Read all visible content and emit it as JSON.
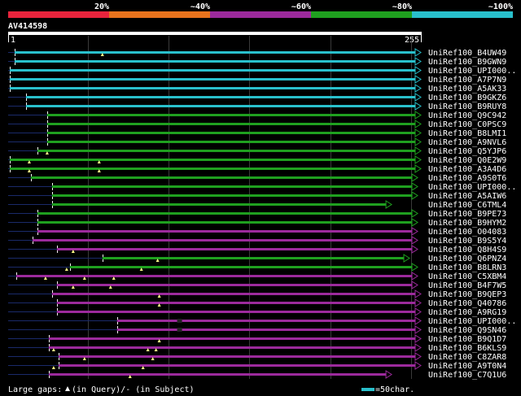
{
  "legend": {
    "segments": [
      {
        "label": "20%",
        "color": "#e8243c"
      },
      {
        "label": "~40%",
        "color": "#e8731d"
      },
      {
        "label": "~60%",
        "color": "#9c2a9c"
      },
      {
        "label": "~80%",
        "color": "#1fa01f"
      },
      {
        "label": "~100%",
        "color": "#29c0cc"
      }
    ]
  },
  "query": {
    "name": "AV414598",
    "start": "1",
    "end": "255",
    "length": 255
  },
  "colors": {
    "cyan": "#29c0cc",
    "green": "#1fa01f",
    "purple": "#9c2a9c",
    "gap": "#1a2a6a"
  },
  "hits": [
    {
      "name": "UniRef100_B4UW49",
      "color": "cyan",
      "start": 5,
      "end": 255,
      "gaps": [],
      "marks": [
        59
      ]
    },
    {
      "name": "UniRef100_B9GWN9",
      "color": "cyan",
      "start": 5,
      "end": 255,
      "gaps": [],
      "marks": []
    },
    {
      "name": "UniRef100_UPI000..",
      "color": "cyan",
      "start": 2,
      "end": 255,
      "gaps": [],
      "marks": []
    },
    {
      "name": "UniRef100_A7P7N9",
      "color": "cyan",
      "start": 2,
      "end": 255,
      "gaps": [],
      "marks": []
    },
    {
      "name": "UniRef100_A5AK33",
      "color": "cyan",
      "start": 2,
      "end": 255,
      "gaps": [],
      "marks": []
    },
    {
      "name": "UniRef100_B9GKZ6",
      "color": "cyan",
      "start": 12,
      "end": 255,
      "gaps": [],
      "marks": []
    },
    {
      "name": "UniRef100_B9RUY8",
      "color": "cyan",
      "start": 12,
      "end": 255,
      "gaps": [],
      "marks": []
    },
    {
      "name": "UniRef100_Q9C942",
      "color": "green",
      "start": 25,
      "end": 255,
      "gaps": [],
      "marks": []
    },
    {
      "name": "UniRef100_C0PSC9",
      "color": "green",
      "start": 25,
      "end": 255,
      "gaps": [],
      "marks": []
    },
    {
      "name": "UniRef100_B8LMI1",
      "color": "green",
      "start": 25,
      "end": 255,
      "gaps": [],
      "marks": []
    },
    {
      "name": "UniRef100_A9NVL6",
      "color": "green",
      "start": 25,
      "end": 255,
      "gaps": [],
      "marks": []
    },
    {
      "name": "UniRef100_Q5YJP6",
      "color": "green",
      "start": 19,
      "end": 255,
      "gaps": [],
      "marks": [
        25
      ]
    },
    {
      "name": "UniRef100_Q0E2W9",
      "color": "green",
      "start": 2,
      "end": 255,
      "gaps": [],
      "marks": [
        14,
        57
      ]
    },
    {
      "name": "UniRef100_A3A4D6",
      "color": "green",
      "start": 2,
      "end": 255,
      "gaps": [],
      "marks": [
        14,
        57
      ]
    },
    {
      "name": "UniRef100_A9S0T6",
      "color": "green",
      "start": 15,
      "end": 253,
      "gaps": [],
      "marks": []
    },
    {
      "name": "UniRef100_UPI000..",
      "color": "green",
      "start": 28,
      "end": 253,
      "gaps": [],
      "marks": []
    },
    {
      "name": "UniRef100_A5AIW6",
      "color": "green",
      "start": 28,
      "end": 253,
      "gaps": [],
      "marks": []
    },
    {
      "name": "UniRef100_C6TML4",
      "color": "green",
      "start": 28,
      "end": 237,
      "gaps": [],
      "marks": []
    },
    {
      "name": "UniRef100_B9PE73",
      "color": "green",
      "start": 19,
      "end": 253,
      "gaps": [],
      "marks": []
    },
    {
      "name": "UniRef100_B9HYM2",
      "color": "green",
      "start": 19,
      "end": 253,
      "gaps": [],
      "marks": []
    },
    {
      "name": "UniRef100_O04083",
      "color": "purple",
      "start": 19,
      "end": 253,
      "gaps": [],
      "marks": []
    },
    {
      "name": "UniRef100_B9S5Y4",
      "color": "purple",
      "start": 16,
      "end": 253,
      "gaps": [],
      "marks": []
    },
    {
      "name": "UniRef100_Q8H4S9",
      "color": "purple",
      "start": 31,
      "end": 253,
      "gaps": [],
      "marks": [
        41
      ]
    },
    {
      "name": "UniRef100_Q6PNZ4",
      "color": "green",
      "start": 59,
      "end": 248,
      "gaps": [],
      "marks": [
        93
      ]
    },
    {
      "name": "UniRef100_B8LRN3",
      "color": "green",
      "start": 39,
      "end": 253,
      "gaps": [],
      "marks": [
        37,
        83
      ]
    },
    {
      "name": "UniRef100_C5XBM4",
      "color": "purple",
      "start": 6,
      "end": 253,
      "gaps": [],
      "marks": [
        24,
        48,
        66
      ]
    },
    {
      "name": "UniRef100_B4F7W5",
      "color": "purple",
      "start": 31,
      "end": 253,
      "gaps": [],
      "marks": [
        41,
        64
      ]
    },
    {
      "name": "UniRef100_B9QEP3",
      "color": "purple",
      "start": 28,
      "end": 255,
      "gaps": [],
      "marks": [
        94
      ]
    },
    {
      "name": "UniRef100_Q40786",
      "color": "purple",
      "start": 31,
      "end": 255,
      "gaps": [],
      "marks": [
        94
      ]
    },
    {
      "name": "UniRef100_A9RG19",
      "color": "purple",
      "start": 31,
      "end": 255,
      "gaps": [],
      "marks": []
    },
    {
      "name": "UniRef100_UPI000..",
      "color": "purple",
      "start": 68,
      "end": 255,
      "gaps": [
        [
          105,
          108
        ]
      ],
      "marks": []
    },
    {
      "name": "UniRef100_Q9SN46",
      "color": "purple",
      "start": 68,
      "end": 255,
      "gaps": [
        [
          105,
          108
        ]
      ],
      "marks": []
    },
    {
      "name": "UniRef100_B9Q1D7",
      "color": "purple",
      "start": 26,
      "end": 255,
      "gaps": [],
      "marks": [
        94
      ]
    },
    {
      "name": "UniRef100_B6KLS9",
      "color": "purple",
      "start": 26,
      "end": 255,
      "gaps": [],
      "marks": [
        29,
        87,
        92
      ]
    },
    {
      "name": "UniRef100_C8ZAR8",
      "color": "purple",
      "start": 32,
      "end": 255,
      "gaps": [],
      "marks": [
        48,
        90
      ]
    },
    {
      "name": "UniRef100_A9T0N4",
      "color": "purple",
      "start": 32,
      "end": 255,
      "gaps": [],
      "marks": [
        29,
        84
      ]
    },
    {
      "name": "UniRef100_C7Q1U6",
      "color": "purple",
      "start": 26,
      "end": 237,
      "gaps": [],
      "marks": [
        76
      ]
    }
  ],
  "footer": {
    "gaps_label": "Large gaps:",
    "gaps_desc": "(in Query)/- (in Subject)",
    "scale_label": "=50char."
  }
}
